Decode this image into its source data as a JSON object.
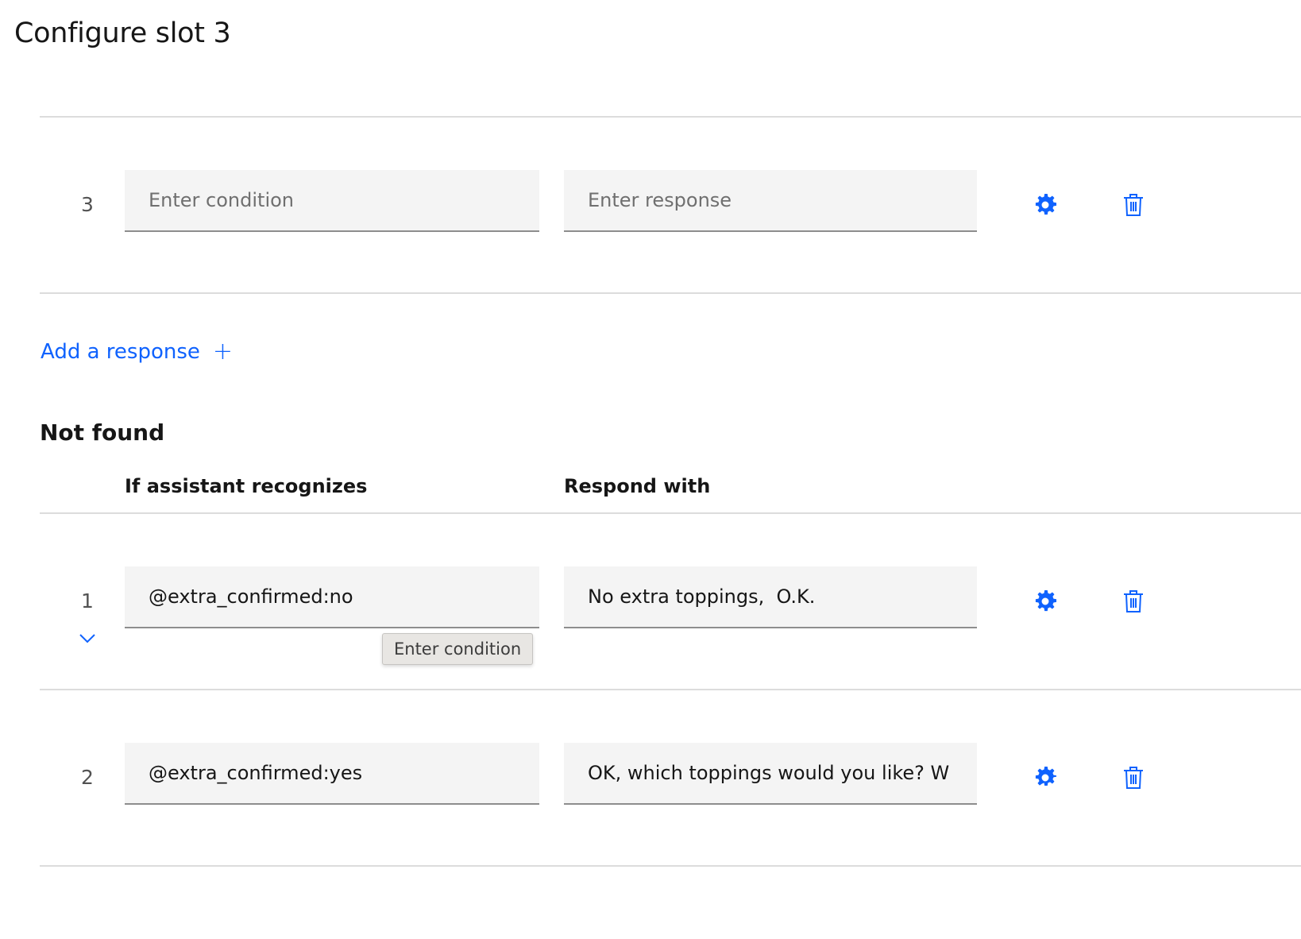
{
  "page": {
    "title": "Configure slot 3"
  },
  "top_section": {
    "rows": [
      {
        "number": "3",
        "condition": "",
        "condition_placeholder": "Enter condition",
        "response": "",
        "response_placeholder": "Enter response"
      }
    ],
    "add_response_label": "Add a response",
    "add_response_icon": "+"
  },
  "not_found": {
    "title": "Not found",
    "col_condition": "If assistant recognizes",
    "col_response": "Respond with",
    "rows": [
      {
        "number": "1",
        "condition": "@extra_confirmed:no",
        "condition_placeholder": "Enter condition",
        "response": "No extra toppings,  O.K.",
        "response_placeholder": "Enter response"
      },
      {
        "number": "2",
        "condition": "@extra_confirmed:yes",
        "condition_placeholder": "Enter condition",
        "response": "OK, which toppings would you like? W",
        "response_placeholder": "Enter response"
      }
    ],
    "tooltip": "Enter condition"
  },
  "icons": {
    "settings": "gear-icon",
    "delete": "trash-icon",
    "expand": "chevron-down-icon"
  },
  "colors": {
    "accent": "#0f62fe",
    "field_bg": "#f4f4f4",
    "divider": "#dcdcdc"
  }
}
